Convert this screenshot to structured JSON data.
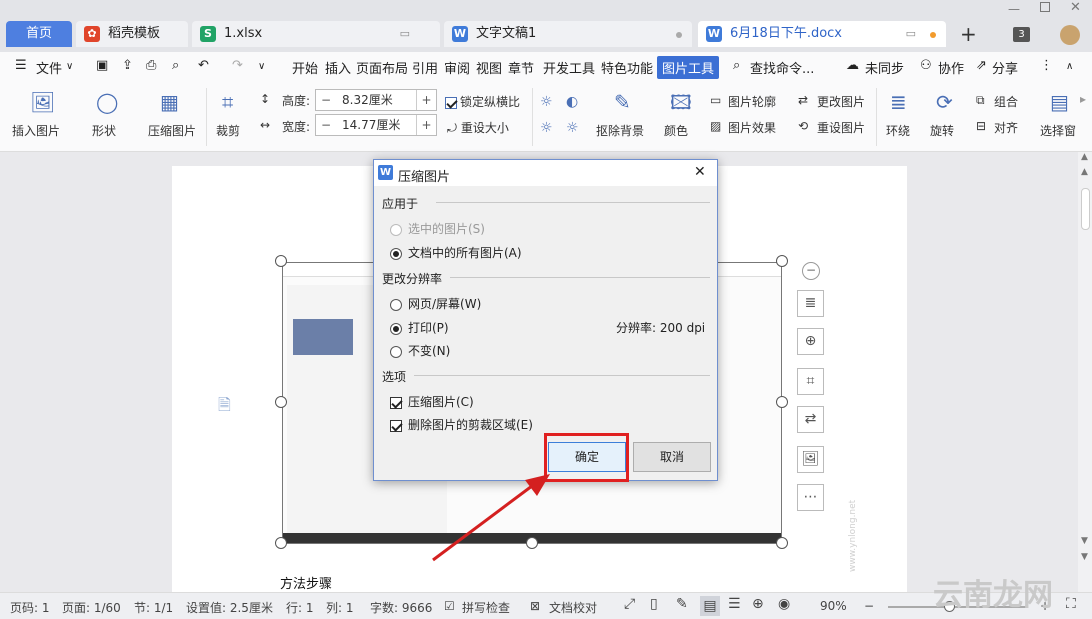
{
  "tabs": {
    "home": "首页",
    "items": [
      {
        "label": "稻壳模板",
        "icon": "daoke-icon"
      },
      {
        "label": "1.xlsx",
        "icon": "sheet-icon"
      },
      {
        "label": "文字文稿1",
        "icon": "word-icon"
      },
      {
        "label": "6月18日下午.docx",
        "icon": "word-icon"
      }
    ],
    "add": "+",
    "count": "3"
  },
  "menu": {
    "file": "文件",
    "items": [
      "开始",
      "插入",
      "页面布局",
      "引用",
      "审阅",
      "视图",
      "章节",
      "开发工具",
      "特色功能"
    ],
    "active": "图片工具",
    "search": "查找命令...",
    "sync": "未同步",
    "collab": "协作",
    "share": "分享"
  },
  "ribbon": {
    "insert_picture": "插入图片",
    "shape": "形状",
    "compress": "压缩图片",
    "crop": "裁剪",
    "height_label": "高度:",
    "height_value": "8.32厘米",
    "width_label": "宽度:",
    "width_value": "14.77厘米",
    "lock_ratio": "锁定纵横比",
    "reset_size": "重设大小",
    "remove_bg": "抠除背景",
    "color": "颜色",
    "outline": "图片轮廓",
    "effect": "图片效果",
    "change": "更改图片",
    "reset_pic": "重设图片",
    "wrap": "环绕",
    "rotate": "旋转",
    "group": "组合",
    "align": "对齐",
    "select_pane": "选择窗"
  },
  "dialog": {
    "title": "压缩图片",
    "apply_group": "应用于",
    "apply_selected": "选中的图片(S)",
    "apply_all": "文档中的所有图片(A)",
    "resolution_group": "更改分辨率",
    "res_web": "网页/屏幕(W)",
    "res_print": "打印(P)",
    "res_none": "不变(N)",
    "resolution_text": "分辨率:  200 dpi",
    "options_group": "选项",
    "opt_compress": "压缩图片(C)",
    "opt_delete_crop": "删除图片的剪裁区域(E)",
    "ok": "确定",
    "cancel": "取消"
  },
  "document": {
    "heading": "方法步骤"
  },
  "status": {
    "page": "页码: 1",
    "pages": "页面: 1/60",
    "section": "节: 1/1",
    "setting": "设置值: 2.5厘米",
    "row": "行: 1",
    "col": "列: 1",
    "words": "字数: 9666",
    "spell": "拼写检查",
    "proof": "文档校对",
    "zoom": "90%"
  },
  "watermark": {
    "text": "云南龙网",
    "url": "www.ynlong.net"
  },
  "colors": {
    "accent": "#3b6fd4",
    "highlight": "#e02020"
  }
}
